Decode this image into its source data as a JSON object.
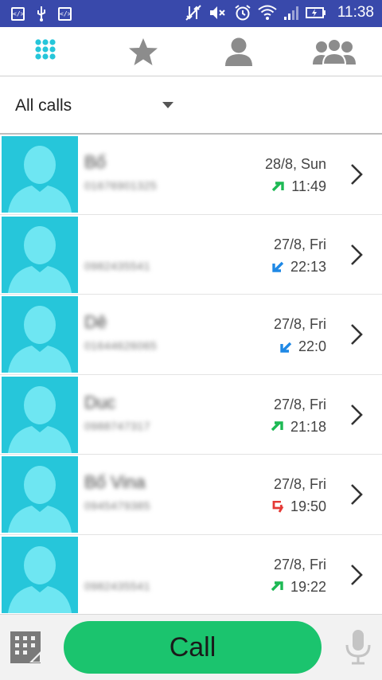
{
  "status_bar": {
    "time": "11:38",
    "left_icons": [
      "code-box-icon",
      "usb-icon",
      "code-box-icon"
    ],
    "right_icons": [
      "data-off-icon",
      "mute-icon",
      "alarm-icon",
      "wifi-icon",
      "signal-icon",
      "battery-icon"
    ]
  },
  "tabs": [
    {
      "icon": "dialpad-icon",
      "active": true
    },
    {
      "icon": "star-icon",
      "active": false
    },
    {
      "icon": "person-icon",
      "active": false
    },
    {
      "icon": "group-icon",
      "active": false
    }
  ],
  "filter": {
    "label": "All calls"
  },
  "calls": [
    {
      "name": "Bố",
      "number": "01676901325",
      "date": "28/8, Sun",
      "time": "11:49",
      "type": "outgoing"
    },
    {
      "name": "",
      "number": "0982435541",
      "date": "27/8, Fri",
      "time": "22:13",
      "type": "incoming"
    },
    {
      "name": "Dê",
      "number": "01644626065",
      "date": "27/8, Fri",
      "time": "22:0",
      "type": "incoming"
    },
    {
      "name": "Duc",
      "number": "0988747317",
      "date": "27/8, Fri",
      "time": "21:18",
      "type": "outgoing"
    },
    {
      "name": "Bố Vina",
      "number": "0945479385",
      "date": "27/8, Fri",
      "time": "19:50",
      "type": "missed"
    },
    {
      "name": "",
      "number": "0982435541",
      "date": "27/8, Fri",
      "time": "19:22",
      "type": "outgoing"
    }
  ],
  "bottom": {
    "call_label": "Call"
  },
  "colors": {
    "status_bar": "#3949ab",
    "accent": "#26c6da",
    "call_button": "#1bc46e",
    "outgoing": "#1db954",
    "incoming": "#1e88e5",
    "missed": "#e53935"
  }
}
